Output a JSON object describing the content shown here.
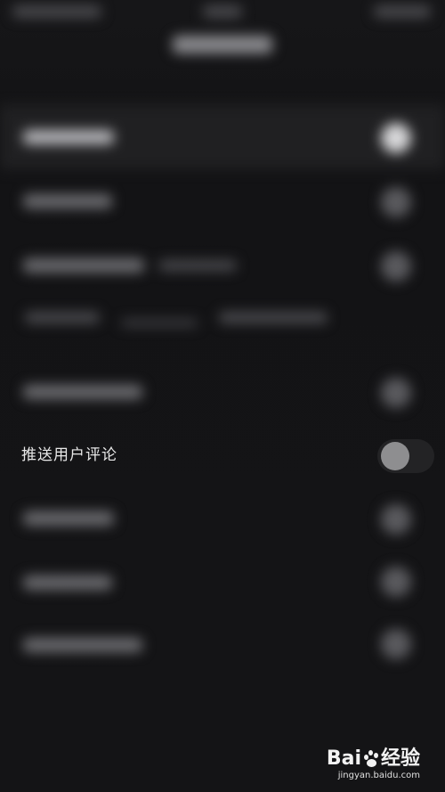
{
  "settings": {
    "push_user_comments": {
      "label": "推送用户评论",
      "enabled": false
    }
  },
  "watermark": {
    "brand_left": "Bai",
    "brand_right": "经验",
    "url": "jingyan.baidu.com"
  }
}
